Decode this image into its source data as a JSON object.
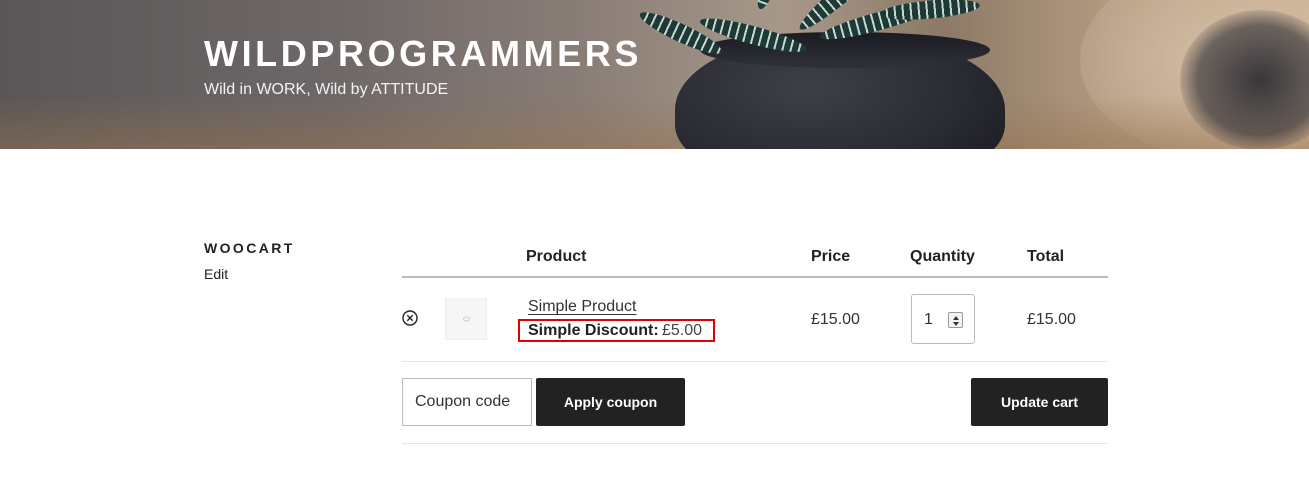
{
  "header": {
    "site_title": "WILDPROGRAMMERS",
    "tagline": "Wild in WORK, Wild by ATTITUDE"
  },
  "page": {
    "title": "WOOCART",
    "edit_label": "Edit"
  },
  "cart": {
    "columns": [
      "Product",
      "Price",
      "Quantity",
      "Total"
    ],
    "items": [
      {
        "product_name": "Simple Product",
        "meta_label": "Simple Discount:",
        "meta_value": "£5.00",
        "price": "£15.00",
        "quantity": "1",
        "total": "£15.00"
      }
    ],
    "coupon_placeholder": "Coupon code",
    "apply_coupon_label": "Apply coupon",
    "update_cart_label": "Update cart"
  },
  "colors": {
    "button_bg": "#222222",
    "highlight_border": "#e00000"
  }
}
